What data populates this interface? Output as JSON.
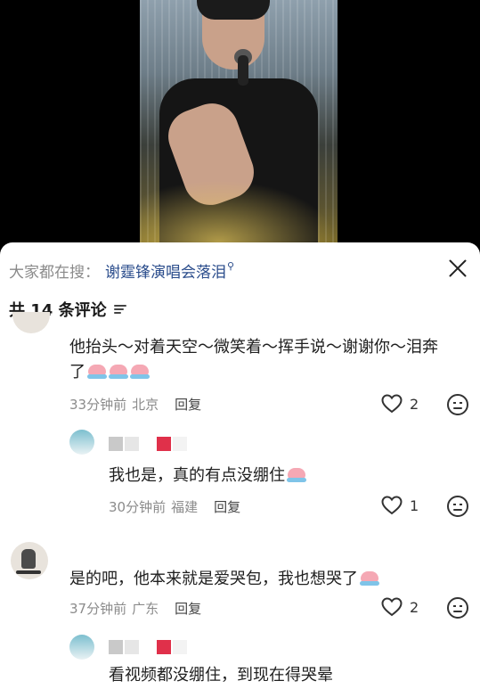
{
  "video": {
    "alt": ""
  },
  "header": {
    "search_prefix": "大家都在搜：",
    "search_term": "谢霆锋演唱会落泪"
  },
  "comments_count_label": "共 14 条评论",
  "comments": [
    {
      "text_line1": "他抬头～对着天空～微笑着～挥手说～谢谢你～泪奔",
      "text_line2": "了",
      "time": "33分钟前",
      "location": "北京",
      "reply_label": "回复",
      "likes": "2"
    },
    {
      "text": "我也是，真的有点没绷住",
      "time": "30分钟前",
      "location": "福建",
      "reply_label": "回复",
      "likes": "1"
    },
    {
      "text": "是的吧，他本来就是爱哭包，我也想哭了",
      "time": "37分钟前",
      "location": "广东",
      "reply_label": "回复",
      "likes": "2"
    },
    {
      "text": "看视频都没绷住，到现在得哭晕"
    }
  ],
  "colors": {
    "link_blue": "#2b4d8c",
    "meta_gray": "#8b8b8b"
  },
  "icons": [
    "search-icon",
    "close-icon",
    "sort-icon",
    "heart-icon",
    "dislike-icon",
    "crying-emoji-icon"
  ]
}
